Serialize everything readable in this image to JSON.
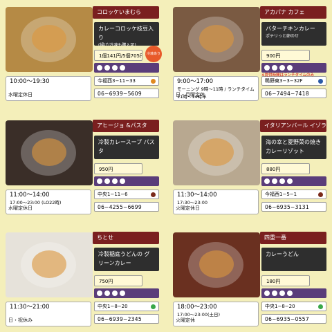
{
  "cards": [
    {
      "shop": "コロッケいまむら",
      "menu": "カレーコロッケ枝豆入り",
      "menu_sub": "(揚げ/冷凍も購入可)",
      "price": "1個141円/5個705円",
      "tag": "冷凍あり",
      "hours": "10:00〜19:30",
      "hours2": "",
      "closed": "水曜定休日",
      "addr": "今福西3−11−33",
      "phone": "06−6939−5609",
      "note": "",
      "dot_color": "#e08a20",
      "photo_color": "#b58a45"
    },
    {
      "shop": "アカパナ カフェ",
      "menu": "バターチキンカレー",
      "menu_sub": "ポテリっと卵のせ",
      "price": "900円",
      "tag": "",
      "hours": "9:00〜17:00",
      "hours2": "モーニング 9時〜11時 / ランチタイム 11時〜14時半",
      "closed": "日・月曜定休",
      "addr": "鴫野東3−3−32F",
      "phone": "06−7494−7418",
      "note": "※提供時間はランチタイムのみ",
      "dot_color": "#2a5aa8",
      "photo_color": "#7a5a42"
    },
    {
      "shop": "アヒージョ &パスタ",
      "menu": "冷製カレースープ パスタ",
      "menu_sub": "",
      "price": "950円",
      "tag": "",
      "hours": "11:00〜14:00",
      "hours2": "17:00〜23:00 (LO22時)",
      "closed": "水曜定休日",
      "addr": "中央1−11−6",
      "phone": "06−4255−6699",
      "note": "",
      "dot_color": "#7a2a1a",
      "photo_color": "#3a2e28"
    },
    {
      "shop": "イタリアンバール イゾラ",
      "menu": "海の幸と夏野菜の焼きカレーリゾット",
      "menu_sub": "",
      "price": "880円",
      "tag": "",
      "hours": "11:30〜14:00",
      "hours2": "17:30〜23:00",
      "closed": "火曜定休日",
      "addr": "今福西1−5−1",
      "phone": "06−6935−3131",
      "note": "",
      "dot_color": "#7a2a1a",
      "photo_color": "#b8a890"
    },
    {
      "shop": "ちとせ",
      "menu": "冷製稲庭うどんの グリーンカレー",
      "menu_sub": "",
      "price": "750円",
      "tag": "",
      "hours": "11:30〜21:00",
      "hours2": "",
      "closed": "日・祝休み",
      "addr": "中央1−8−20",
      "phone": "06−6939−2345",
      "note": "",
      "dot_color": "#3aa84a",
      "photo_color": "#e6e2da"
    },
    {
      "shop": "四重一番",
      "menu": "カレーうどん",
      "menu_sub": "",
      "price": "180円",
      "tag": "",
      "hours": "18:00〜23:00",
      "hours2": "17:00〜23:00(土日)",
      "closed": "火曜定休",
      "addr": "中央1−8−20",
      "phone": "06−6935−0557",
      "note": "",
      "dot_color": "#3aa84a",
      "photo_color": "#6a3020"
    }
  ]
}
